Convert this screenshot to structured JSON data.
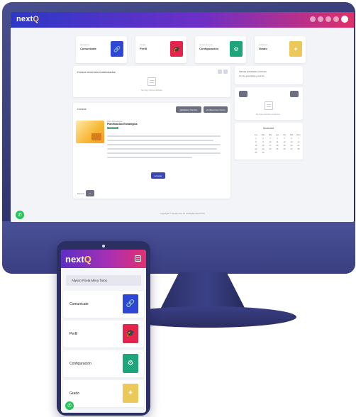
{
  "brand": {
    "prefix": "next",
    "accent": "Q"
  },
  "tiles": [
    {
      "caption": "Mensagens",
      "label": "Comunicate",
      "icon": "link-icon",
      "glyph": "🔗",
      "color": "#2f45d6"
    },
    {
      "caption": "Usuario",
      "label": "Perfil",
      "icon": "graduation-cap-icon",
      "glyph": "🎓",
      "color": "#e4244d"
    },
    {
      "caption": "Ajustes da conta",
      "label": "Configuración",
      "icon": "gear-icon",
      "glyph": "⚙",
      "color": "#1ea57a"
    },
    {
      "caption": "Avaliacoes",
      "label": "Grado",
      "icon": "certificate-icon",
      "glyph": "✦",
      "color": "#ecc85b"
    }
  ],
  "panels": {
    "featured_title": "Cursos recientes matriculados",
    "featured_empty": "No hay cursos visibles",
    "course_section": "Cursos",
    "filter_btn": "Alfabético Nombre",
    "view_btn": "Ver/Resumen Curso",
    "course_tag": "Disponible",
    "course_name_top": "Plan Estratégico",
    "course_name": "Planificación Estratégica",
    "enroll_btn": "Acceder",
    "page_btn": "1",
    "page_prefix": "Mostrar",
    "notif_title": "Últimas actividades próximas",
    "notif_item": "No hay actividades próximas",
    "side_empty": "No hay eventos próximos",
    "calendar_month": "Noviembre",
    "calendar_days": [
      "Lun",
      "Mar",
      "Mié",
      "Jue",
      "Vie",
      "Sáb",
      "Dom",
      "1",
      "2",
      "3",
      "4",
      "5",
      "6",
      "7",
      "8",
      "9",
      "10",
      "11",
      "12",
      "13",
      "14",
      "15",
      "16",
      "17",
      "18",
      "19",
      "20",
      "21",
      "22",
      "23",
      "24",
      "25",
      "26",
      "27",
      "28",
      "29",
      "30"
    ]
  },
  "footer": "Copyright © NextQ.com.br. All Rights Reserved",
  "phone": {
    "user_name": "Allyson Poeta Menu Tutos",
    "cards": [
      {
        "label": "Comunicate",
        "icon": "link-icon",
        "glyph": "🔗",
        "color": "#2f45d6"
      },
      {
        "label": "Perfil",
        "icon": "graduation-cap-icon",
        "glyph": "🎓",
        "color": "#e4244d"
      },
      {
        "label": "Configuración",
        "icon": "gear-icon",
        "glyph": "⚙",
        "color": "#1ea57a"
      },
      {
        "label": "Grado",
        "icon": "certificate-icon",
        "glyph": "✦",
        "color": "#ecc85b"
      }
    ]
  }
}
